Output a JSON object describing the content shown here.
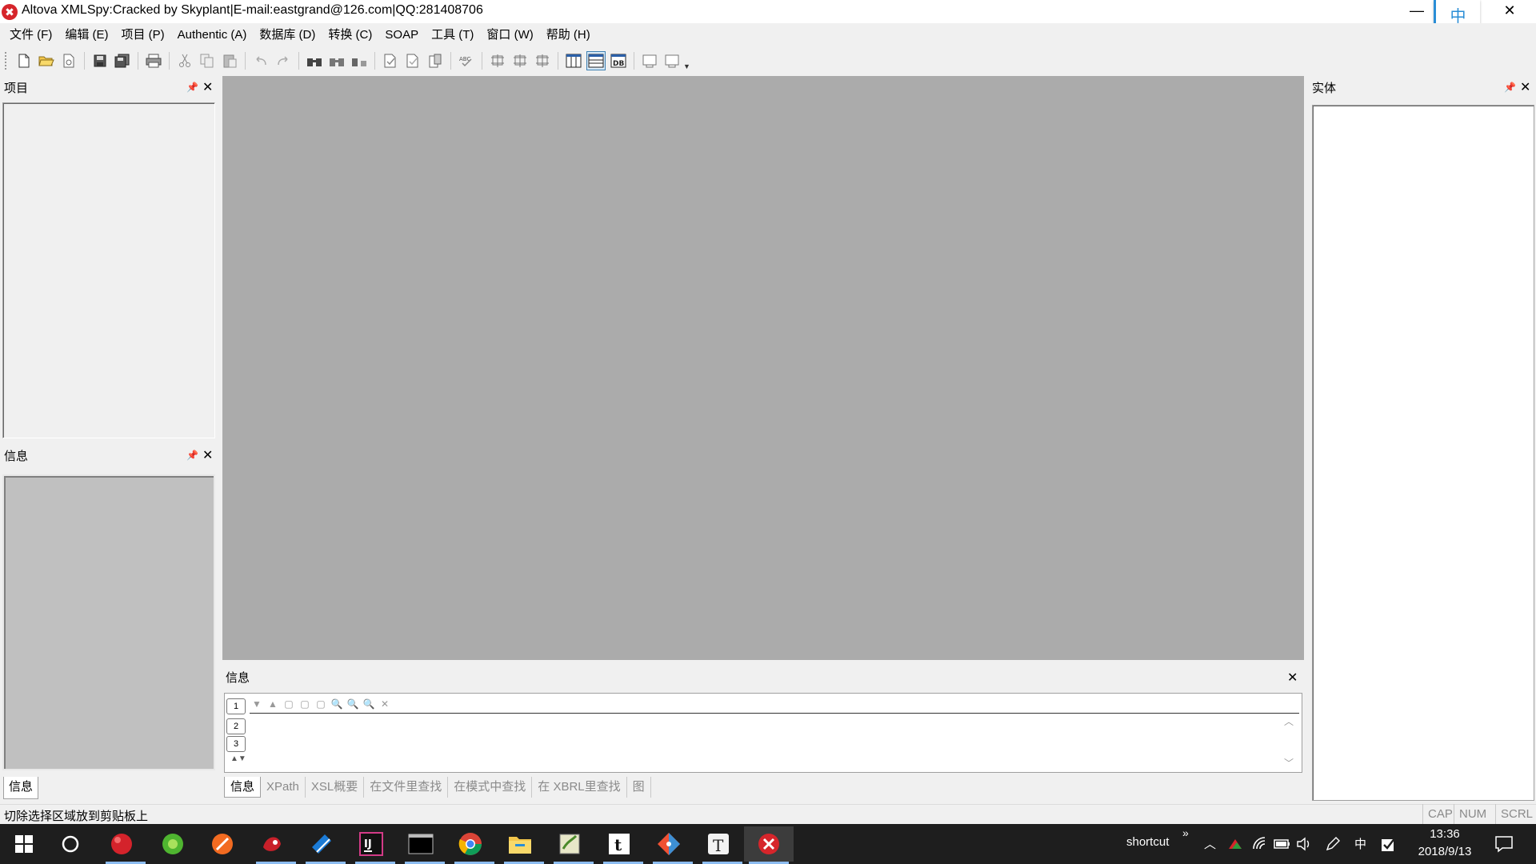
{
  "window": {
    "title": "Altova XMLSpy:Cracked by Skyplant|E-mail:eastgrand@126.com|QQ:281408706",
    "app_icon_glyph": "✖",
    "minimize_glyph": "—",
    "close_glyph": "✕",
    "ime_label": "中"
  },
  "menu": {
    "items": [
      "文件 (F)",
      "编辑 (E)",
      "项目 (P)",
      "Authentic (A)",
      "数据库 (D)",
      "转换 (C)",
      "SOAP",
      "工具 (T)",
      "窗口 (W)",
      "帮助 (H)"
    ]
  },
  "toolbar": {
    "buttons": [
      "new-icon",
      "open-icon",
      "reload-icon",
      "save-icon",
      "save-all-icon",
      "print-icon",
      "cut-icon",
      "copy-icon",
      "paste-icon",
      "undo-icon",
      "redo-icon",
      "find-icon",
      "find-next-icon",
      "replace-icon",
      "check-wellformed-icon",
      "validate-icon",
      "dtd-icon",
      "spellcheck-icon",
      "text-view-icon",
      "grid-view-icon",
      "schema-view-icon",
      "enhanced-grid-icon",
      "browser-view-icon",
      "db-view-icon",
      "xslt-icon",
      "xquery-icon"
    ],
    "active_button": "browser-view-icon"
  },
  "panels": {
    "project": {
      "title": "项目"
    },
    "info_left": {
      "title": "信息",
      "tab_label": "信息"
    },
    "entity": {
      "title": "实体"
    },
    "info_bottom": {
      "title": "信息"
    }
  },
  "info_window": {
    "page_tabs": [
      "1",
      "2",
      "3"
    ],
    "bottom_tabs": [
      "信息",
      "XPath",
      "XSL概要",
      "在文件里查找",
      "在模式中查找",
      "在 XBRL里查找",
      "图"
    ],
    "active_tab": "信息"
  },
  "statusbar": {
    "text": "切除选择区域放到剪贴板上",
    "indicators": [
      "CAP",
      "NUM",
      "SCRL"
    ]
  },
  "taskbar": {
    "apps": [
      "cherry-app-icon",
      "green-app-icon",
      "orange-app-icon",
      "red-app-icon",
      "blue-app-icon",
      "intellij-icon",
      "terminal-icon",
      "chrome-icon",
      "explorer-icon",
      "notepad-plus-icon",
      "typora-icon",
      "git-icon",
      "typewriter-icon",
      "xmlspy-icon"
    ],
    "shortcut_label": "shortcut",
    "chevron": "»",
    "ime": "中",
    "time": "13:36",
    "date": "2018/9/13"
  }
}
